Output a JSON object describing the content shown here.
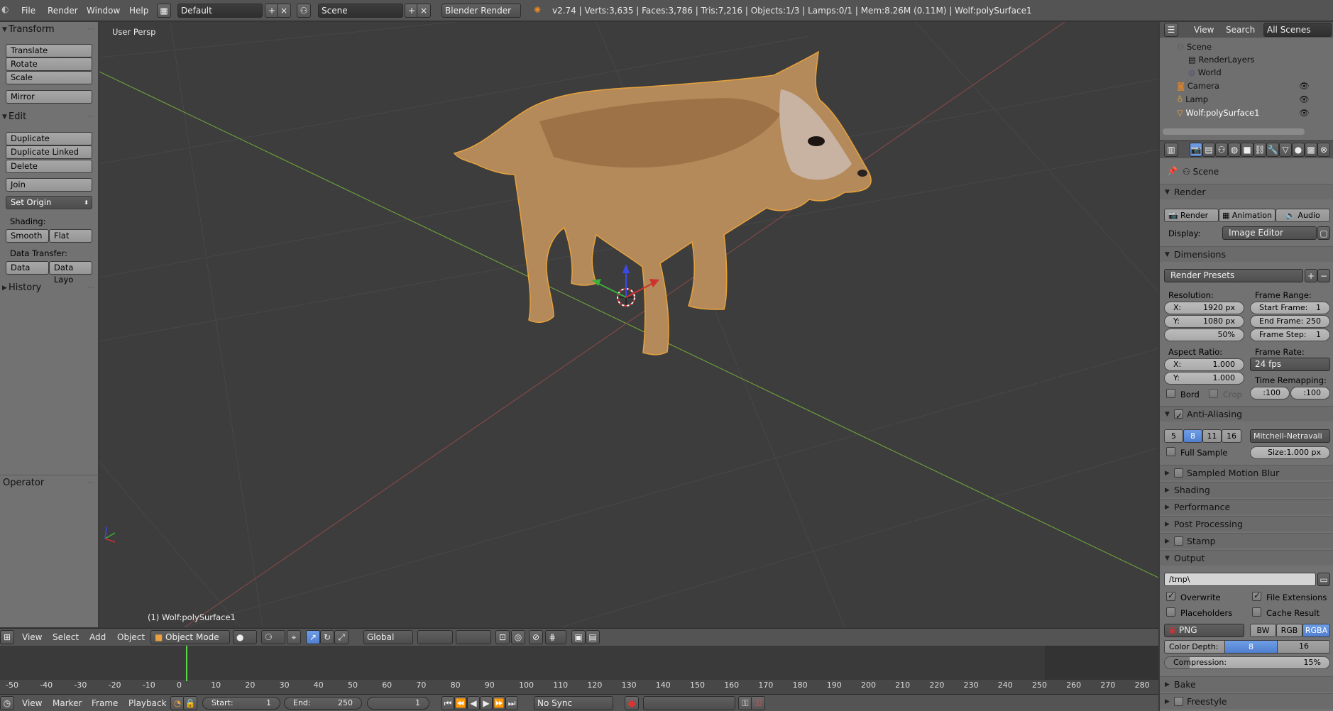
{
  "topbar": {
    "menus": [
      "File",
      "Render",
      "Window",
      "Help"
    ],
    "layout": "Default",
    "scene": "Scene",
    "engine": "Blender Render",
    "stats": "v2.74 | Verts:3,635 | Faces:3,786 | Tris:7,216 | Objects:1/3 | Lamps:0/1 | Mem:8.26M (0.11M) | Wolf:polySurface1"
  },
  "toolshelf": {
    "transform": {
      "title": "Transform",
      "buttons": [
        "Translate",
        "Rotate",
        "Scale",
        "Mirror"
      ]
    },
    "edit": {
      "title": "Edit",
      "buttons": [
        "Duplicate",
        "Duplicate Linked",
        "Delete",
        "Join"
      ],
      "set_origin": "Set Origin"
    },
    "shading_label": "Shading:",
    "shading": [
      "Smooth",
      "Flat"
    ],
    "data_transfer_label": "Data Transfer:",
    "data_transfer": [
      "Data",
      "Data Layo"
    ],
    "history": "History",
    "operator": "Operator"
  },
  "viewport": {
    "view_label": "User Persp",
    "object_label": "(1) Wolf:polySurface1"
  },
  "viewport_header": {
    "menus": [
      "View",
      "Select",
      "Add",
      "Object"
    ],
    "mode": "Object Mode",
    "orientation": "Global"
  },
  "timeline": {
    "ticks": [
      "-50",
      "-40",
      "-30",
      "-20",
      "-10",
      "0",
      "10",
      "20",
      "30",
      "40",
      "50",
      "60",
      "70",
      "80",
      "90",
      "100",
      "110",
      "120",
      "130",
      "140",
      "150",
      "160",
      "170",
      "180",
      "190",
      "200",
      "210",
      "220",
      "230",
      "240",
      "250",
      "260",
      "270",
      "280"
    ],
    "menus": [
      "View",
      "Marker",
      "Frame",
      "Playback"
    ],
    "start_label": "Start:",
    "start_value": "1",
    "end_label": "End:",
    "end_value": "250",
    "current": "1",
    "sync": "No Sync"
  },
  "outliner": {
    "menus": [
      "View",
      "Search"
    ],
    "filter": "All Scenes",
    "items": [
      "Scene",
      "RenderLayers",
      "World",
      "Camera",
      "Lamp",
      "Wolf:polySurface1"
    ]
  },
  "properties": {
    "context": "Scene",
    "render": {
      "title": "Render",
      "buttons": [
        "Render",
        "Animation",
        "Audio"
      ],
      "display_label": "Display:",
      "display": "Image Editor"
    },
    "dimensions": {
      "title": "Dimensions",
      "presets": "Render Presets",
      "resolution_label": "Resolution:",
      "res_x": "1920 px",
      "res_y": "1080 px",
      "res_pct": "50%",
      "frame_range_label": "Frame Range:",
      "start_frame_label": "Start Frame:",
      "start_frame": "1",
      "end_frame_label": "End Frame:",
      "end_frame": "250",
      "frame_step_label": "Frame Step:",
      "frame_step": "1",
      "aspect_label": "Aspect Ratio:",
      "aspect_x": "1.000",
      "aspect_y": "1.000",
      "frame_rate_label": "Frame Rate:",
      "frame_rate": "24 fps",
      "time_remap_label": "Time Remapping:",
      "remap_old": ":100",
      "remap_new": ":100",
      "bord": "Bord",
      "crop": "Crop"
    },
    "antialiasing": {
      "title": "Anti-Aliasing",
      "samples": [
        "5",
        "8",
        "11",
        "16"
      ],
      "filter": "Mitchell-Netravali",
      "full_sample": "Full Sample",
      "size_label": "Size:",
      "size": "1.000 px"
    },
    "collapsed_panels": [
      "Sampled Motion Blur",
      "Shading",
      "Performance",
      "Post Processing",
      "Stamp"
    ],
    "output": {
      "title": "Output",
      "path": "/tmp\\",
      "overwrite": "Overwrite",
      "file_extensions": "File Extensions",
      "placeholders": "Placeholders",
      "cache_result": "Cache Result",
      "format": "PNG",
      "color_modes": [
        "BW",
        "RGB",
        "RGBA"
      ],
      "depth_label": "Color Depth:",
      "depths": [
        "8",
        "16"
      ],
      "compression_label": "Compression:",
      "compression": "15%"
    },
    "bottom_panels": [
      "Bake",
      "Freestyle"
    ]
  }
}
